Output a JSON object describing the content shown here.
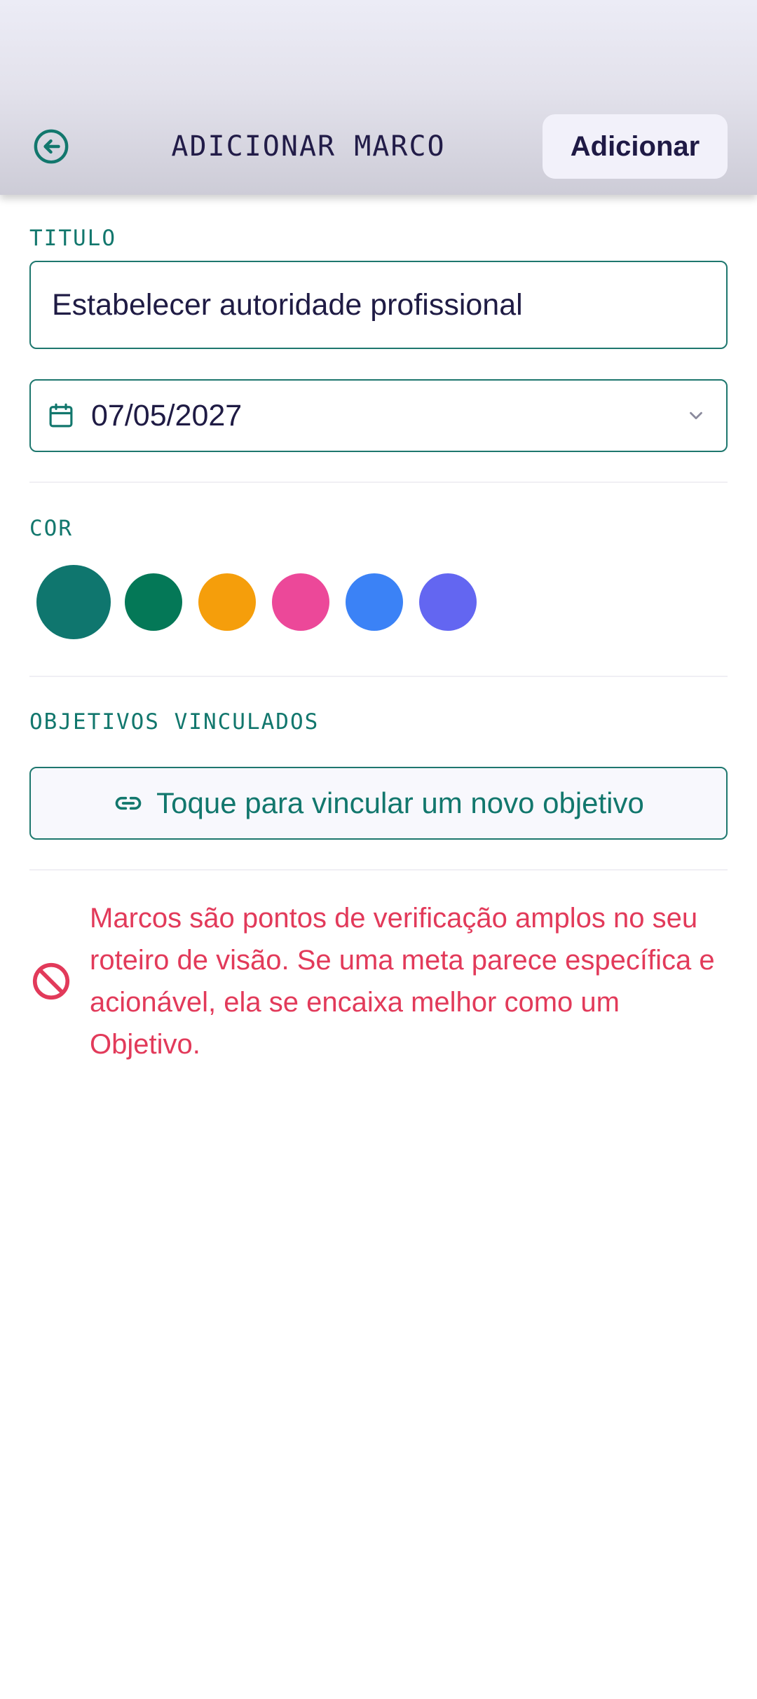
{
  "header": {
    "title": "ADICIONAR MARCO",
    "add_label": "Adicionar",
    "back_icon": "arrow-left-circle-icon"
  },
  "form": {
    "title_label": "TITULO",
    "title_value": "Estabelecer autoridade profissional",
    "date_value": "07/05/2027",
    "date_icon": "calendar-icon",
    "color_label": "COR",
    "colors": [
      "#0f766e",
      "#047857",
      "#f59e0b",
      "#ec4899",
      "#3b82f6",
      "#6366f1"
    ],
    "selected_color": "#0f766e",
    "objectives_label": "OBJETIVOS VINCULADOS",
    "link_objective_label": "Toque para vincular um novo objetivo",
    "link_icon": "link-icon"
  },
  "notice": {
    "icon": "ban-icon",
    "text": "Marcos são pontos de verificação amplos no seu roteiro de visão. Se uma meta parece específica e acionável, ela se encaixa melhor como um Objetivo.",
    "color": "#e23a5a"
  },
  "theme": {
    "accent": "#12776d",
    "text_dark": "#1f1b44"
  }
}
